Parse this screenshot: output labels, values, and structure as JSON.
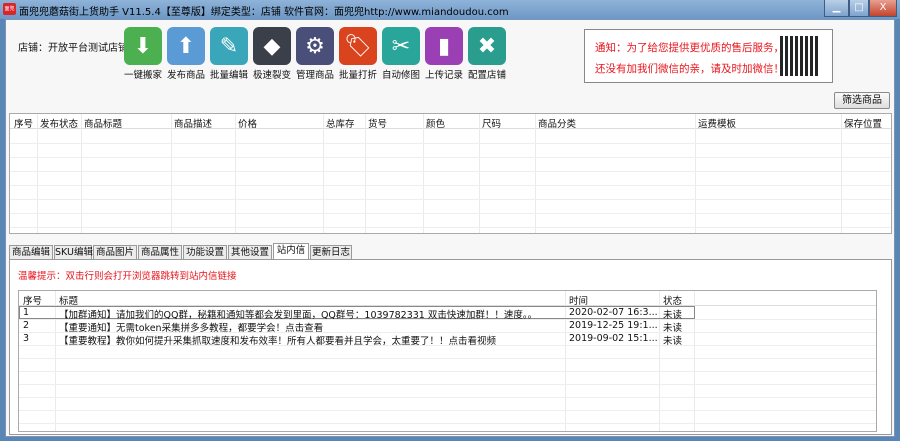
{
  "window": {
    "title": "面兜兜蘑菇街上货助手 V11.5.4【至尊版】绑定类型：店铺  软件官网：面兜兜http://www.miandoudou.com",
    "app_icon": "面兜",
    "minimize": "▁",
    "maximize": "□",
    "close": "X"
  },
  "shop_label": "店铺：开放平台测试店铺",
  "toolbar": [
    {
      "label": "一键搬家",
      "icon": "cloud-download-icon",
      "color": "#4caf50",
      "glyph": "⬇"
    },
    {
      "label": "发布商品",
      "icon": "cloud-upload-icon",
      "color": "#5b9bd5",
      "glyph": "⬆"
    },
    {
      "label": "批量编辑",
      "icon": "edit-document-icon",
      "color": "#3aa6b9",
      "glyph": "✎"
    },
    {
      "label": "极速裂变",
      "icon": "layers-icon",
      "color": "#3a3f4a",
      "glyph": "◆"
    },
    {
      "label": "管理商品",
      "icon": "gear-icon",
      "color": "#4a4f7a",
      "glyph": "⚙"
    },
    {
      "label": "批量打折",
      "icon": "tag-icon",
      "color": "#d9431e",
      "glyph": "🏷"
    },
    {
      "label": "自动修图",
      "icon": "scissors-icon",
      "color": "#2aa59a",
      "glyph": "✂"
    },
    {
      "label": "上传记录",
      "icon": "bookmark-icon",
      "color": "#9b3fb5",
      "glyph": "▮"
    },
    {
      "label": "配置店铺",
      "icon": "tools-icon",
      "color": "#2a9d8f",
      "glyph": "✖"
    }
  ],
  "notice": {
    "line1": "通知：为了给您提供更优质的售后服务，",
    "line2": "还没有加我们微信的亲，请及时加微信！"
  },
  "filter_button": "筛选商品",
  "product_table": {
    "columns": [
      "序号",
      "发布状态",
      "商品标题",
      "商品描述",
      "价格",
      "总库存",
      "货号",
      "颜色",
      "尺码",
      "商品分类",
      "运费模板",
      "保存位置"
    ]
  },
  "tabs": [
    "商品编辑",
    "SKU编辑",
    "商品图片",
    "商品属性",
    "功能设置",
    "其他设置",
    "站内信",
    "更新日志"
  ],
  "active_tab": 6,
  "hint": "温馨提示：双击行则会打开浏览器跳转到站内信链接",
  "messages": {
    "columns": [
      "序号",
      "标题",
      "时间",
      "状态"
    ],
    "rows": [
      {
        "no": "1",
        "title": "【加群通知】请加我们的QQ群，秘籍和通知等都会发到里面，QQ群号：1039782331 双击快速加群！！速度。。",
        "time": "2020-02-07 16:3...",
        "status": "未读"
      },
      {
        "no": "2",
        "title": "【重要通知】无需token采集拼多多教程，都要学会！点击查看",
        "time": "2019-12-25 19:1...",
        "status": "未读"
      },
      {
        "no": "3",
        "title": "【重要教程】教你如何提升采集抓取速度和发布效率！所有人都要看并且学会，太重要了！！点击看视频",
        "time": "2019-09-02 15:1...",
        "status": "未读"
      }
    ]
  }
}
